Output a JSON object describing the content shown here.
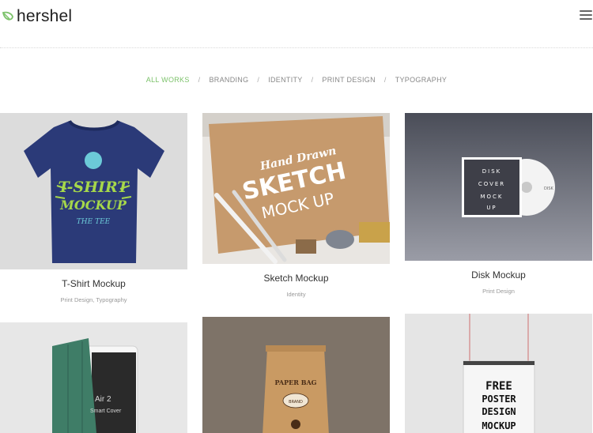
{
  "header": {
    "logo_text": "hershel",
    "accent": "#7cc26a"
  },
  "filters": {
    "items": [
      "ALL WORKS",
      "BRANDING",
      "IDENTITY",
      "PRINT DESIGN",
      "TYPOGRAPHY"
    ],
    "separator": "/",
    "active": "ALL WORKS"
  },
  "portfolio": [
    {
      "title": "T-Shirt Mockup",
      "category": "Print Design, Typography",
      "art_text": [
        "T-SHIRT",
        "MOCKUP",
        "THE TEE"
      ]
    },
    {
      "title": "Sketch Mockup",
      "category": "Identity",
      "art_text": [
        "Hand Drawn",
        "SKETCH",
        "MOCK UP"
      ]
    },
    {
      "title": "Disk Mockup",
      "category": "Print Design",
      "art_text": [
        "DISK",
        "COVER",
        "MOCK",
        "UP",
        "DISK"
      ]
    },
    {
      "title": "",
      "category": "",
      "art_text": [
        "Air 2",
        "Smart Cover"
      ]
    },
    {
      "title": "",
      "category": "",
      "art_text": [
        "PAPER BAG",
        "BRAND"
      ]
    },
    {
      "title": "",
      "category": "",
      "art_text": [
        "FREE",
        "POSTER",
        "DESIGN",
        "MOCKUP"
      ]
    }
  ]
}
